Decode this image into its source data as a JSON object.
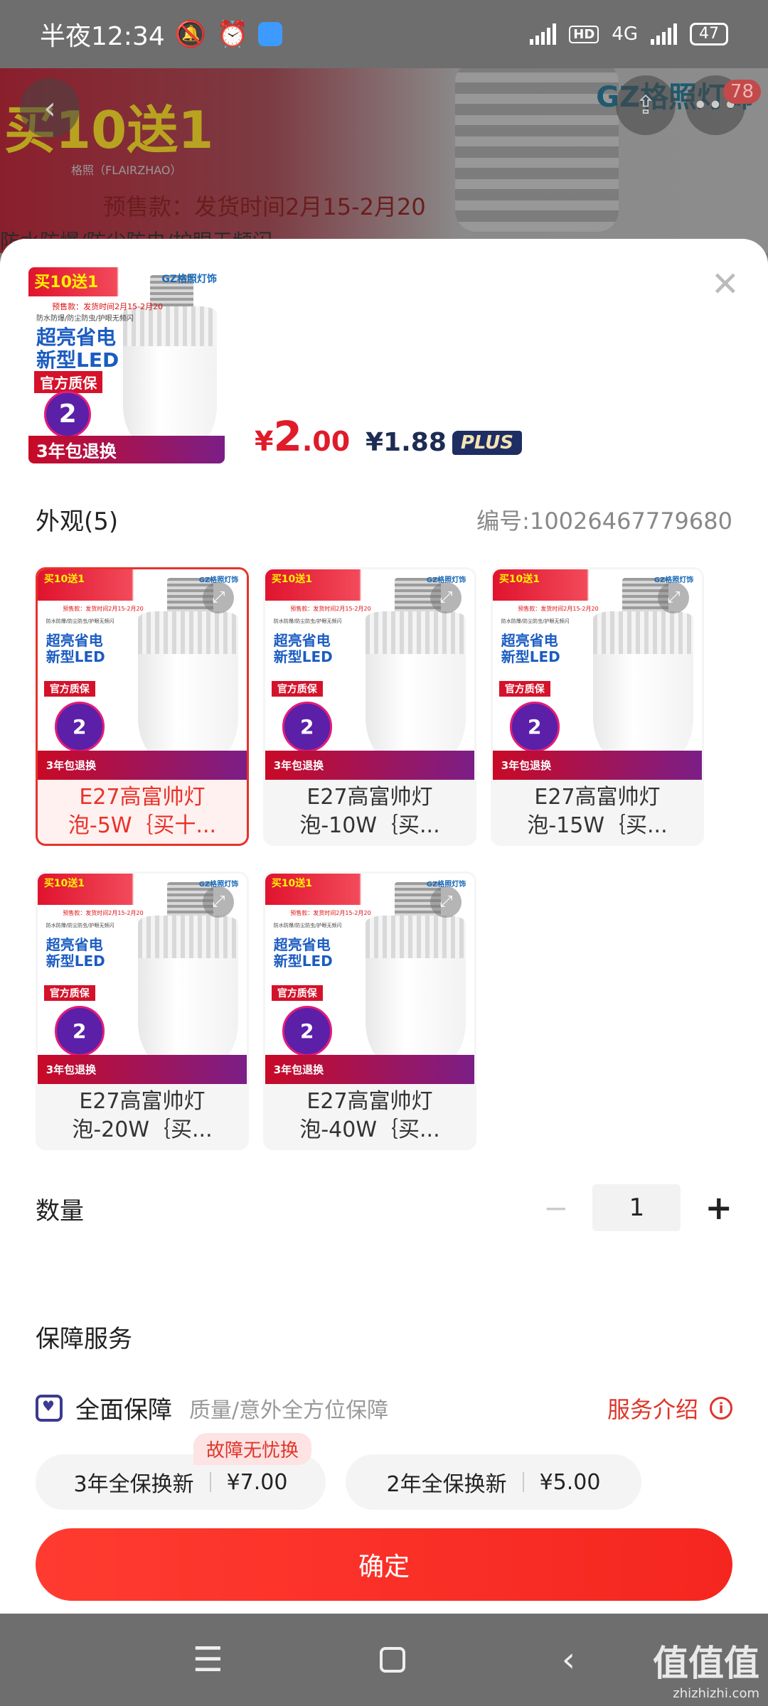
{
  "status_bar": {
    "time": "半夜12:34",
    "network": "4G",
    "hd": "HD",
    "battery": "47"
  },
  "background": {
    "promo": "买10送1",
    "brand_line": "格照（FLAIRZHAO）",
    "presale": "预售款：发货时间2月15-2月20",
    "sub": "防水防爆/防尘防虫/护眼无频闪",
    "logo": "GZ格照灯饰",
    "cart_count": "78"
  },
  "product": {
    "currency": "¥",
    "price_int": "2",
    "price_dec": ".00",
    "plus_price": "¥1.88",
    "plus_label": "PLUS",
    "thumb_art": {
      "promo": "买10送1",
      "logo": "GZ格照灯饰",
      "presale": "预售款：发货时间2月15-2月20",
      "features": "防水防爆/防尘防虫/护眼无频闪",
      "headline_1": "超亮省电",
      "headline_2": "新型LED",
      "quality": "官方质保",
      "price_badge": "2",
      "footer": "3年包退换"
    }
  },
  "variants": {
    "title": "外观(5)",
    "code": "编号:10026467779680",
    "items": [
      {
        "label": "E27高富帅灯泡-5W｛买十...",
        "selected": true
      },
      {
        "label": "E27高富帅灯泡-10W｛买...",
        "selected": false
      },
      {
        "label": "E27高富帅灯泡-15W｛买...",
        "selected": false
      },
      {
        "label": "E27高富帅灯泡-20W｛买...",
        "selected": false
      },
      {
        "label": "E27高富帅灯泡-40W｛买...",
        "selected": false
      }
    ]
  },
  "quantity": {
    "label": "数量",
    "value": "1",
    "minus": "−",
    "plus": "+"
  },
  "service": {
    "title": "保障服务",
    "name": "全面保障",
    "desc": "质量/意外全方位保障",
    "link": "服务介绍",
    "options": [
      {
        "name": "3年全保换新",
        "price": "¥7.00",
        "tag": "故障无忧换"
      },
      {
        "name": "2年全保换新",
        "price": "¥5.00"
      }
    ]
  },
  "confirm_label": "确定",
  "watermark": {
    "main": "值值值",
    "sub": "zhizhizhi.com"
  },
  "colors": {
    "accent": "#e8322b",
    "plus_bg": "#1e2e63"
  }
}
